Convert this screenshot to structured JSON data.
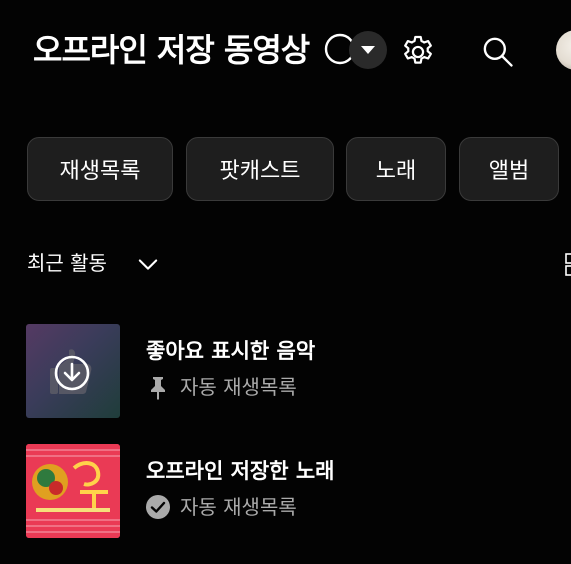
{
  "header": {
    "title": "오프라인 저장 동영상"
  },
  "chips": [
    {
      "label": "재생목록"
    },
    {
      "label": "팟캐스트"
    },
    {
      "label": "노래"
    },
    {
      "label": "앨범"
    }
  ],
  "sort": {
    "label": "최근 활동"
  },
  "items": [
    {
      "title": "좋아요 표시한 음악",
      "subtitle": "자동 재생목록",
      "status_icon": "pin-icon"
    },
    {
      "title": "오프라인 저장한 노래",
      "subtitle": "자동 재생목록",
      "status_icon": "check-circle-icon"
    }
  ],
  "colors": {
    "background": "#030303",
    "chip_bg": "#1e1e1e",
    "chip_border": "#3a3a3a",
    "secondary_text": "#aaaaaa"
  }
}
